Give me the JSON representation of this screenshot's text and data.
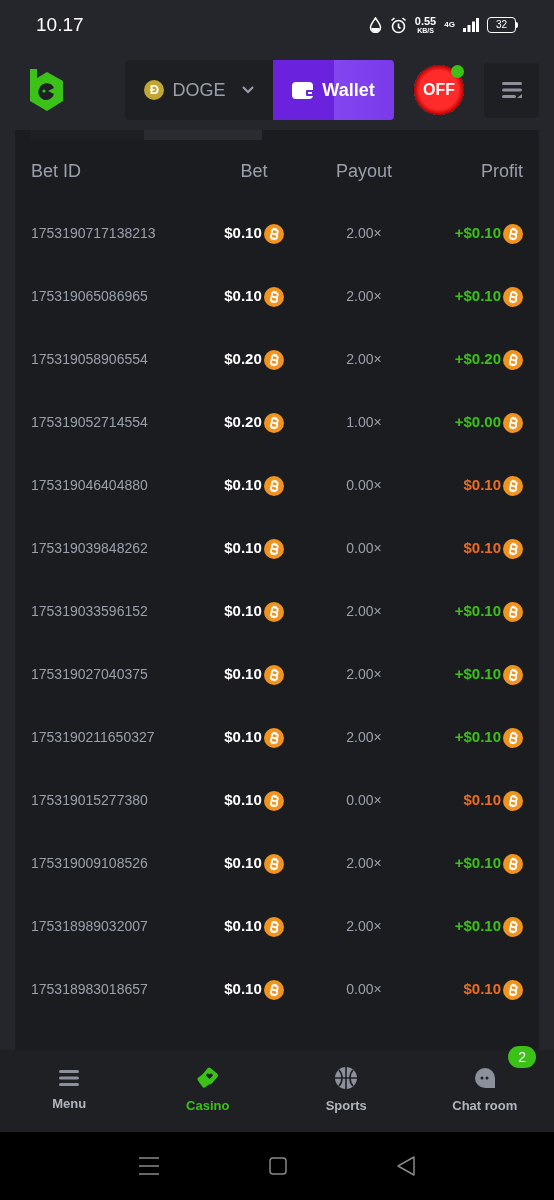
{
  "status_bar": {
    "time": "10.17",
    "speed": "0.55",
    "speed_unit": "KB/S",
    "network": "4G",
    "battery": "32"
  },
  "header": {
    "currency": "DOGE",
    "currency_symbol": "Ð",
    "wallet": "Wallet",
    "toggle": "OFF",
    "toggle_online": true
  },
  "table": {
    "columns": [
      "Bet ID",
      "Bet",
      "Payout",
      "Profit"
    ],
    "rows": [
      {
        "id": "1753190717138213",
        "bet": "$0.10",
        "payout": "2.00×",
        "profit": "+$0.10",
        "kind": "win"
      },
      {
        "id": "175319065086965",
        "bet": "$0.10",
        "payout": "2.00×",
        "profit": "+$0.10",
        "kind": "win"
      },
      {
        "id": "175319058906554",
        "bet": "$0.20",
        "payout": "2.00×",
        "profit": "+$0.20",
        "kind": "win"
      },
      {
        "id": "175319052714554",
        "bet": "$0.20",
        "payout": "1.00×",
        "profit": "+$0.00",
        "kind": "win"
      },
      {
        "id": "175319046404880",
        "bet": "$0.10",
        "payout": "0.00×",
        "profit": "$0.10",
        "kind": "loss"
      },
      {
        "id": "175319039848262",
        "bet": "$0.10",
        "payout": "0.00×",
        "profit": "$0.10",
        "kind": "loss"
      },
      {
        "id": "175319033596152",
        "bet": "$0.10",
        "payout": "2.00×",
        "profit": "+$0.10",
        "kind": "win"
      },
      {
        "id": "175319027040375",
        "bet": "$0.10",
        "payout": "2.00×",
        "profit": "+$0.10",
        "kind": "win"
      },
      {
        "id": "1753190211650327",
        "bet": "$0.10",
        "payout": "2.00×",
        "profit": "+$0.10",
        "kind": "win"
      },
      {
        "id": "175319015277380",
        "bet": "$0.10",
        "payout": "0.00×",
        "profit": "$0.10",
        "kind": "loss"
      },
      {
        "id": "175319009108526",
        "bet": "$0.10",
        "payout": "2.00×",
        "profit": "+$0.10",
        "kind": "win"
      },
      {
        "id": "175318989032007",
        "bet": "$0.10",
        "payout": "2.00×",
        "profit": "+$0.10",
        "kind": "win"
      },
      {
        "id": "175318983018657",
        "bet": "$0.10",
        "payout": "0.00×",
        "profit": "$0.10",
        "kind": "loss"
      }
    ]
  },
  "bottom_nav": [
    {
      "label": "Menu",
      "kind": "menu",
      "selected": false
    },
    {
      "label": "Casino",
      "kind": "casino",
      "selected": true
    },
    {
      "label": "Sports",
      "kind": "sports",
      "selected": false
    },
    {
      "label": "Chat room",
      "kind": "chat",
      "selected": false,
      "badge": "2"
    }
  ]
}
